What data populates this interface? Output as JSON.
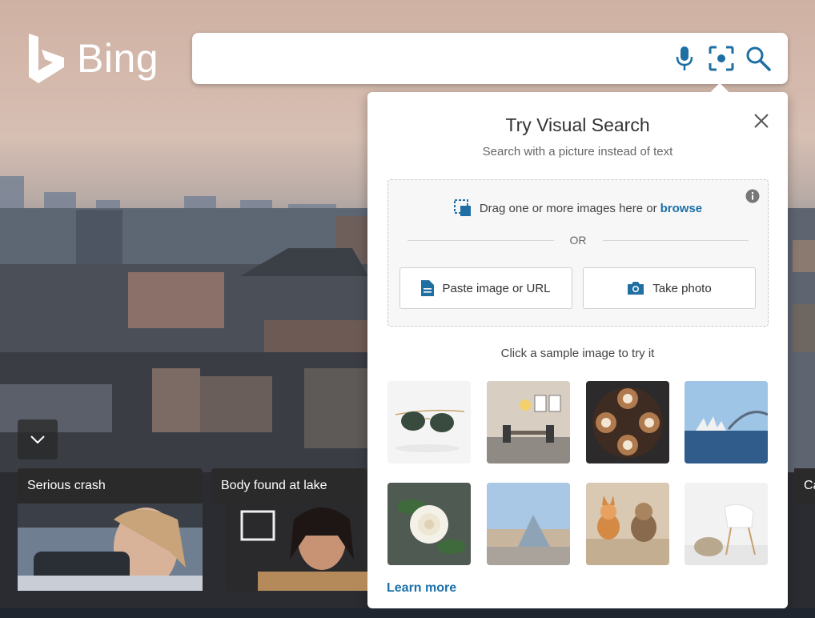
{
  "brand": {
    "wordmark": "Bing",
    "logo_icon": "bing-logo-icon"
  },
  "search": {
    "value": "",
    "icons": [
      "microphone-icon",
      "visual-search-icon",
      "search-icon"
    ]
  },
  "visual_search": {
    "title": "Try Visual Search",
    "subtitle": "Search with a picture instead of text",
    "drag_text": "Drag one or more images here or",
    "browse_label": "browse",
    "or_label": "OR",
    "paste_label": "Paste image or URL",
    "photo_label": "Take photo",
    "sample_label": "Click a sample image to try it",
    "samples": [
      "sunglasses",
      "dining room",
      "latte art",
      "opera house",
      "white rose",
      "louvre pyramid",
      "dogs",
      "white chair"
    ],
    "learn_more": "Learn more"
  },
  "news": {
    "items": [
      {
        "caption": "Serious crash"
      },
      {
        "caption": "Body found at lake"
      },
      {
        "caption": "Ca"
      }
    ]
  },
  "colors": {
    "accent": "#1b70a8",
    "icon_blue": "#1f6fa3"
  }
}
